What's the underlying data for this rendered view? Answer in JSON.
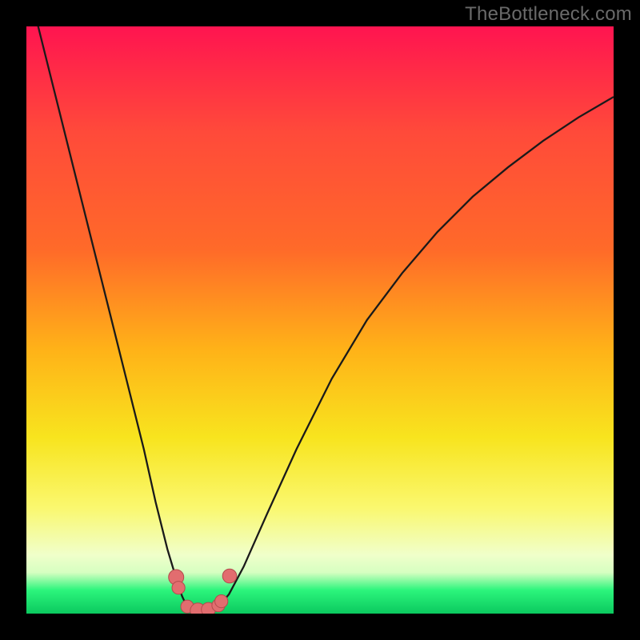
{
  "watermark": "TheBottleneck.com",
  "colors": {
    "frame": "#000000",
    "grad_top": "#ff1450",
    "grad_mid1": "#ff6a29",
    "grad_mid2": "#ffb218",
    "grad_mid3": "#f8e41e",
    "grad_mid4": "#faf86f",
    "grad_bot1": "#f0ffca",
    "grad_bot2": "#2cf57c",
    "grad_bot3": "#0bc95f",
    "curve_stroke": "#1a1a1a",
    "marker_fill": "#e26d6f",
    "marker_stroke": "#b34b4d"
  },
  "chart_data": {
    "type": "line",
    "title": "",
    "xlabel": "",
    "ylabel": "",
    "xlim": [
      0,
      100
    ],
    "ylim": [
      0,
      100
    ],
    "series": [
      {
        "name": "curve",
        "x": [
          0,
          2,
          5,
          8,
          11,
          14,
          17,
          20,
          22,
          24,
          25.5,
          26.5,
          27.2,
          28,
          29,
          30,
          31,
          32,
          33,
          34.5,
          37,
          41,
          46,
          52,
          58,
          64,
          70,
          76,
          82,
          88,
          94,
          100
        ],
        "values": [
          108,
          100,
          88,
          76,
          64,
          52,
          40,
          28,
          19,
          11,
          6,
          3,
          1.5,
          0.8,
          0.4,
          0.3,
          0.4,
          0.8,
          1.5,
          3.3,
          8,
          17,
          28,
          40,
          50,
          58,
          65,
          71,
          76,
          80.5,
          84.5,
          88
        ]
      }
    ],
    "markers": [
      {
        "x": 25.5,
        "y": 6.2,
        "r": 1.3
      },
      {
        "x": 25.9,
        "y": 4.4,
        "r": 1.1
      },
      {
        "x": 27.4,
        "y": 1.2,
        "r": 1.1
      },
      {
        "x": 29.2,
        "y": 0.5,
        "r": 1.3
      },
      {
        "x": 31.0,
        "y": 0.7,
        "r": 1.2
      },
      {
        "x": 32.7,
        "y": 1.4,
        "r": 1.1
      },
      {
        "x": 33.2,
        "y": 2.1,
        "r": 1.1
      },
      {
        "x": 34.6,
        "y": 6.4,
        "r": 1.2
      }
    ]
  }
}
